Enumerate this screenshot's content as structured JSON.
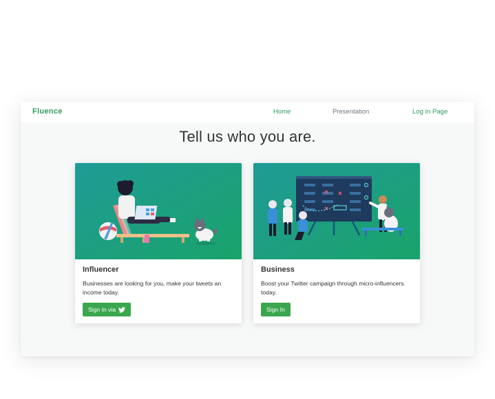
{
  "nav": {
    "brand": "Fluence",
    "links": [
      {
        "label": "Home"
      },
      {
        "label": "Presentation"
      },
      {
        "label": "Log In Page"
      }
    ]
  },
  "headline": "Tell us who you are.",
  "cards": [
    {
      "title": "Influencer",
      "text": "Businesses are looking for you, make your tweets an income today.",
      "button_label": "Sign In via",
      "button_icon": "twitter-icon"
    },
    {
      "title": "Business",
      "text": "Boost your Twitter campaign through micro-influencers today.",
      "button_label": "Sign In"
    }
  ],
  "colors": {
    "brand": "#2e9a5a",
    "button": "#3aa64e",
    "gradient_start": "#1f9b96",
    "gradient_end": "#1aa36a"
  }
}
